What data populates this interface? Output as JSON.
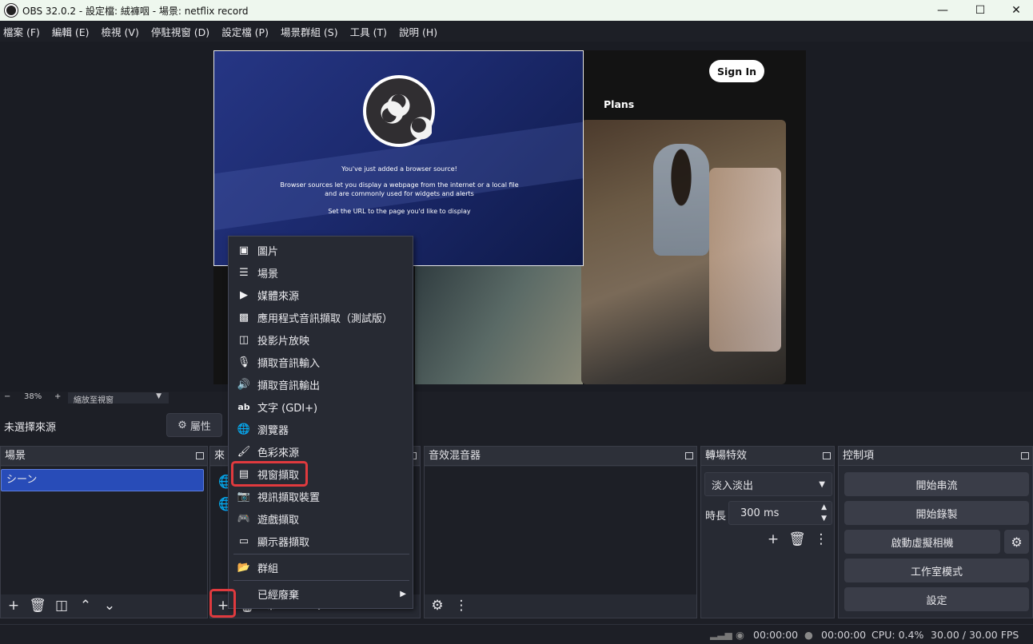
{
  "window": {
    "title": "OBS 32.0.2 - 設定檔: 絨褲咽 - 場景: netflix record"
  },
  "menu": [
    "檔案 (F)",
    "編輯 (E)",
    "檢視 (V)",
    "停駐視窗 (D)",
    "設定檔 (P)",
    "場景群組 (S)",
    "工具 (T)",
    "說明 (H)"
  ],
  "preview": {
    "signin_label": "Sign In",
    "plans_label": "Plans",
    "browser_source": {
      "line1": "You've just added a browser source!",
      "line2": "Browser sources let you display a webpage from the internet or a local file",
      "line3": "and are commonly used for widgets and alerts",
      "line4": "Set the URL to the page you'd like to display"
    }
  },
  "zoom": {
    "minus": "−",
    "value": "38%",
    "plus": "+",
    "mode": "縮放至視窗"
  },
  "source_bar": {
    "no_source": "未選擇來源",
    "properties": "屬性"
  },
  "docks": {
    "scenes": {
      "title": "場景",
      "items": [
        "シーン"
      ]
    },
    "sources": {
      "title": "來"
    },
    "mixer": {
      "title": "音效混音器"
    },
    "transitions": {
      "title": "轉場特效",
      "selected": "淡入淡出",
      "duration_label": "時長",
      "duration_value": "300 ms"
    },
    "controls": {
      "title": "控制項",
      "buttons": [
        "開始串流",
        "開始錄製",
        "啟動虛擬相機",
        "工作室模式",
        "設定"
      ]
    }
  },
  "context_menu": {
    "items": [
      "圖片",
      "場景",
      "媒體來源",
      "應用程式音訊擷取（測試版）",
      "投影片放映",
      "擷取音訊輸入",
      "擷取音訊輸出",
      "文字 (GDI+)",
      "瀏覽器",
      "色彩來源",
      "視窗擷取",
      "視訊擷取裝置",
      "遊戲擷取",
      "顯示器擷取"
    ],
    "icons": [
      "image-icon",
      "list-icon",
      "play-icon",
      "app-audio-icon",
      "slideshow-icon",
      "microphone-icon",
      "speaker-icon",
      "text-icon",
      "globe-icon",
      "brush-icon",
      "window-icon",
      "camera-icon",
      "gamepad-icon",
      "monitor-icon"
    ],
    "group": "群組",
    "deprecated": "已經廢棄"
  },
  "status": {
    "stream_time": "00:00:00",
    "rec_time": "00:00:00",
    "cpu": "CPU: 0.4%",
    "fps": "30.00 / 30.00 FPS"
  },
  "colors": {
    "highlight": "#e03a3e",
    "selected_scene": "#284cb8",
    "background": "#1d1f26"
  }
}
